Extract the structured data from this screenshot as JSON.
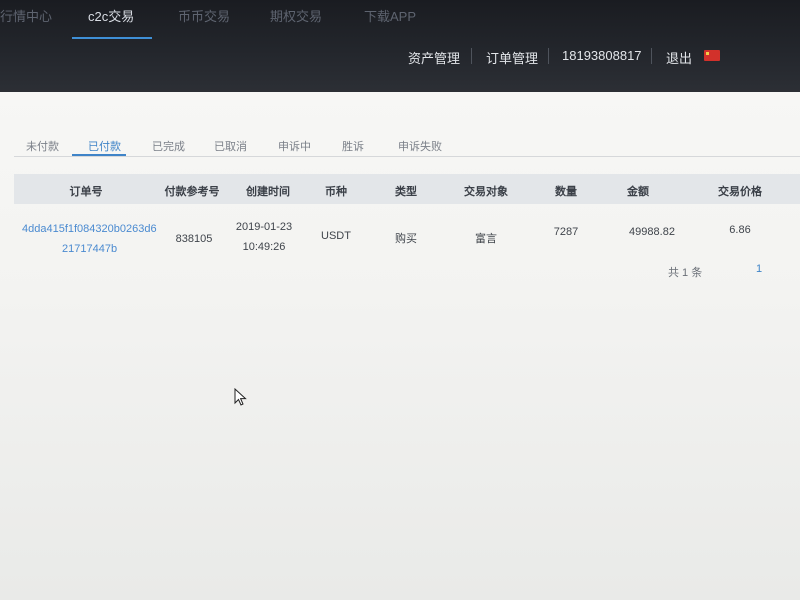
{
  "top_tabs": [
    "行情中心",
    "c2c交易",
    "币币交易",
    "期权交易",
    "下载APP"
  ],
  "right_menu": {
    "assets": "资产管理",
    "orders": "订单管理",
    "phone": "18193808817",
    "logout": "退出",
    "flag_icon": "china-flag-icon"
  },
  "status_tabs": [
    "未付款",
    "已付款",
    "已完成",
    "已取消",
    "申诉中",
    "胜诉",
    "申诉失败"
  ],
  "active_status_tab": "已付款",
  "table": {
    "columns": [
      "订单号",
      "付款参考号",
      "创建时间",
      "币种",
      "类型",
      "交易对象",
      "数量",
      "金额",
      "交易价格"
    ],
    "rows": [
      {
        "order_id_line1": "4dda415f1f084320b0263d6",
        "order_id_line2": "21717447b",
        "ref": "838105",
        "date": "2019-01-23",
        "time": "10:49:26",
        "coin": "USDT",
        "type": "购买",
        "counterparty": "富言",
        "quantity": "7287",
        "amount": "49988.82",
        "price": "6.86"
      }
    ]
  },
  "pager": {
    "total": "共 1 条",
    "page": "1"
  },
  "colors": {
    "accent": "#3f84c8",
    "nav_bg": "#1f2227"
  }
}
